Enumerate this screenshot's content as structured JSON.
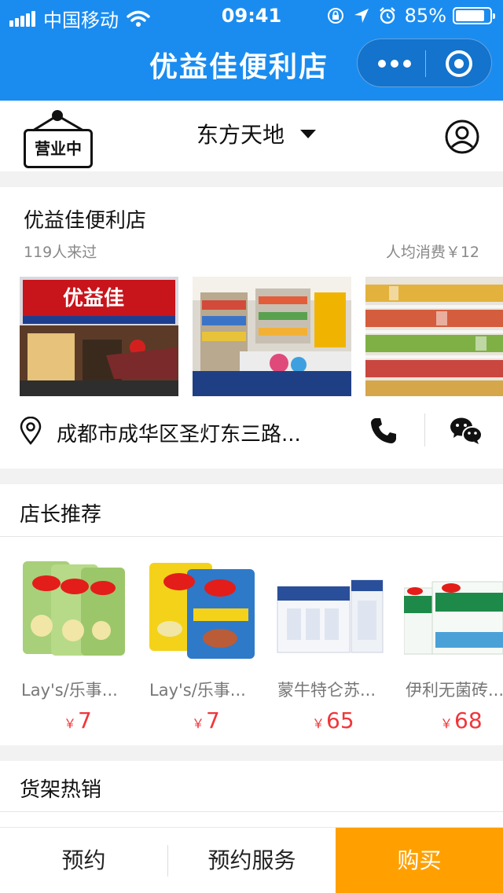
{
  "status_bar": {
    "carrier": "中国移动",
    "time": "09:41",
    "battery": "85%",
    "battery_level": 0.85
  },
  "nav": {
    "title": "优益佳便利店"
  },
  "header": {
    "sign_text": "营业中",
    "location": "东方天地"
  },
  "shop": {
    "name": "优益佳便利店",
    "visits": "119人来过",
    "avg_spend": "人均消费￥12",
    "photos": [
      "storefront-photo",
      "interior-shelves-photo",
      "snack-shelves-photo"
    ],
    "store_sign_text": "优益佳",
    "address": "成都市成华区圣灯东三路..."
  },
  "recommend": {
    "title": "店长推荐",
    "currency": "￥",
    "products": [
      {
        "name": "Lay's/乐事...",
        "price": "7"
      },
      {
        "name": "Lay's/乐事...",
        "price": "7"
      },
      {
        "name": "蒙牛特仑苏...",
        "price": "65"
      },
      {
        "name": "伊利无菌砖...",
        "price": "68"
      }
    ]
  },
  "hot": {
    "title": "货架热销"
  },
  "bottom_bar": {
    "reserve": "预约",
    "reserve_service": "预约服务",
    "buy": "购买"
  },
  "colors": {
    "nav_blue": "#1a8cf0",
    "price_red": "#f0363a",
    "buy_orange": "#ffa000"
  }
}
